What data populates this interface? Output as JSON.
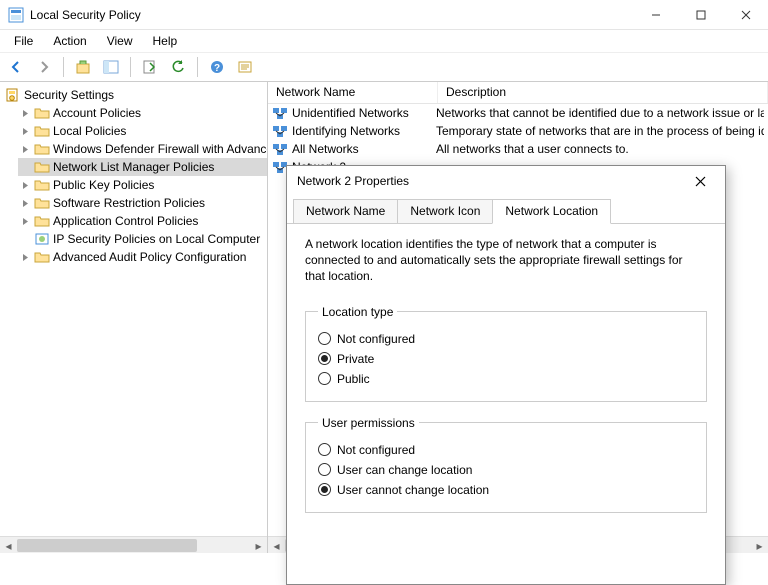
{
  "window": {
    "title": "Local Security Policy"
  },
  "menu": {
    "file": "File",
    "action": "Action",
    "view": "View",
    "help": "Help"
  },
  "tree": {
    "root": "Security Settings",
    "items": [
      {
        "label": "Account Policies"
      },
      {
        "label": "Local Policies"
      },
      {
        "label": "Windows Defender Firewall with Advanced Security"
      },
      {
        "label": "Network List Manager Policies"
      },
      {
        "label": "Public Key Policies"
      },
      {
        "label": "Software Restriction Policies"
      },
      {
        "label": "Application Control Policies"
      },
      {
        "label": "IP Security Policies on Local Computer"
      },
      {
        "label": "Advanced Audit Policy Configuration"
      }
    ]
  },
  "list": {
    "headers": {
      "name": "Network Name",
      "desc": "Description"
    },
    "rows": [
      {
        "name": "Unidentified Networks",
        "desc": "Networks that cannot be identified due to a network issue or lack of"
      },
      {
        "name": "Identifying Networks",
        "desc": "Temporary state of networks that are in the process of being identified"
      },
      {
        "name": "All Networks",
        "desc": "All networks that a user connects to."
      },
      {
        "name": "Network 2",
        "desc": ""
      }
    ]
  },
  "dialog": {
    "title": "Network 2 Properties",
    "tabs": {
      "name": "Network Name",
      "icon": "Network Icon",
      "location": "Network Location"
    },
    "desc": "A network location identifies the type of network that a computer is connected to and automatically sets the appropriate firewall settings for that location.",
    "group1": {
      "legend": "Location type",
      "opt1": "Not configured",
      "opt2": "Private",
      "opt3": "Public",
      "selected": "opt2"
    },
    "group2": {
      "legend": "User permissions",
      "opt1": "Not configured",
      "opt2": "User can change location",
      "opt3": "User cannot change location",
      "selected": "opt3"
    }
  }
}
